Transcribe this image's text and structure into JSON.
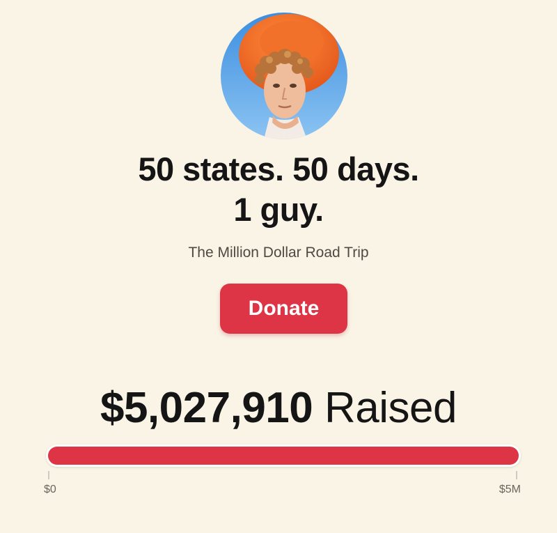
{
  "campaign": {
    "headline_line1": "50 states. 50 days.",
    "headline_line2": "1 guy.",
    "subtitle": "The Million Dollar Road Trip",
    "donate_label": "Donate"
  },
  "fundraising": {
    "amount_raised": "$5,027,910",
    "raised_word": "Raised",
    "progress_fraction": 1.0,
    "scale_min": "$0",
    "scale_max": "$5M"
  },
  "colors": {
    "accent": "#dd3446",
    "background": "#faf4e6",
    "text": "#151515"
  }
}
